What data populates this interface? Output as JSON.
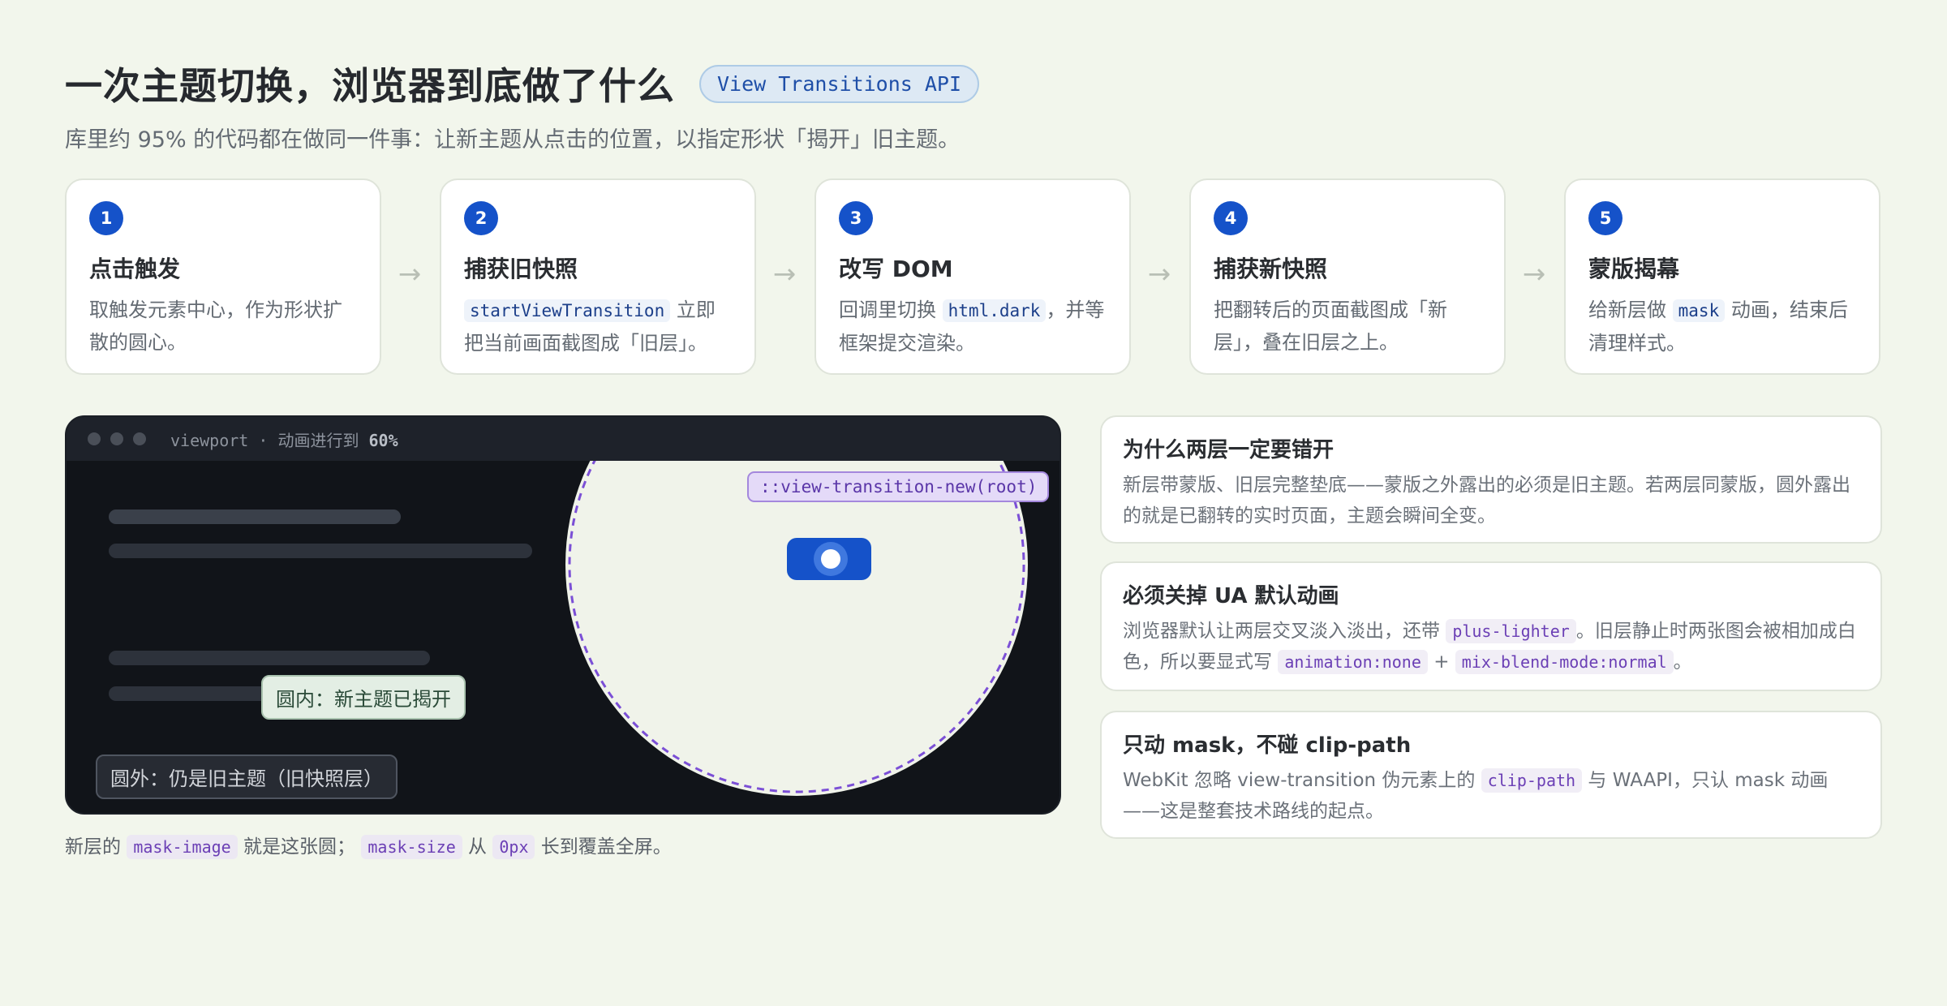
{
  "header": {
    "title": "一次主题切换，浏览器到底做了什么",
    "badge": "View Transitions API",
    "subtitle": "库里约 95% 的代码都在做同一件事：让新主题从点击的位置，以指定形状「揭开」旧主题。"
  },
  "steps": [
    {
      "num": "1",
      "title": "点击触发",
      "desc": "取触发元素中心，作为形状扩散的圆心。"
    },
    {
      "num": "2",
      "title": "捕获旧快照",
      "code": "startViewTransition",
      "desc_after": " 立即把当前画面截图成「旧层」。"
    },
    {
      "num": "3",
      "title": "改写 DOM",
      "desc_before": "回调里切换 ",
      "code": "html.dark",
      "desc_after": "，并等框架提交渲染。"
    },
    {
      "num": "4",
      "title": "捕获新快照",
      "desc": "把翻转后的页面截图成「新层」，叠在旧层之上。"
    },
    {
      "num": "5",
      "title": "蒙版揭幕",
      "desc_before": "给新层做 ",
      "code": "mask",
      "desc_after": " 动画，结束后清理样式。"
    }
  ],
  "arrow_glyph": "→",
  "viewport": {
    "label_prefix": "viewport · 动画进行到 ",
    "label_progress": "60%",
    "progress": 0.6,
    "pseudo_label": "::view-transition-new(root)",
    "inside_label": "圆内：新主题已揭开",
    "outside_label": "圆外：仍是旧主题（旧快照层）",
    "colors": {
      "old_bg": "#111419",
      "new_bg": "#f0f3ea",
      "ring": "#7b4fd6",
      "toggle": "#1552c9"
    }
  },
  "caption": {
    "t1": "新层的 ",
    "c1": "mask-image",
    "t2": " 就是这张圆； ",
    "c2": "mask-size",
    "t3": " 从 ",
    "c3": "0px",
    "t4": " 长到覆盖全屏。"
  },
  "notes": [
    {
      "title": "为什么两层一定要错开",
      "body": "新层带蒙版、旧层完整垫底——蒙版之外露出的必须是旧主题。若两层同蒙版，圆外露出的就是已翻转的实时页面，主题会瞬间全变。"
    },
    {
      "title": "必须关掉 UA 默认动画",
      "t1": "浏览器默认让两层交叉淡入淡出，还带 ",
      "c1": "plus-lighter",
      "t2": "。旧层静止时两张图会被相加成白色，所以要显式写 ",
      "c2": "animation:none",
      "t3": " + ",
      "c3": "mix-blend-mode:normal",
      "t4": "。"
    },
    {
      "title": "只动 mask，不碰 clip-path",
      "t1": "WebKit 忽略 view-transition 伪元素上的 ",
      "c1": "clip-path",
      "t2": " 与 WAAPI，只认 mask 动画——这是整套技术路线的起点。"
    }
  ]
}
